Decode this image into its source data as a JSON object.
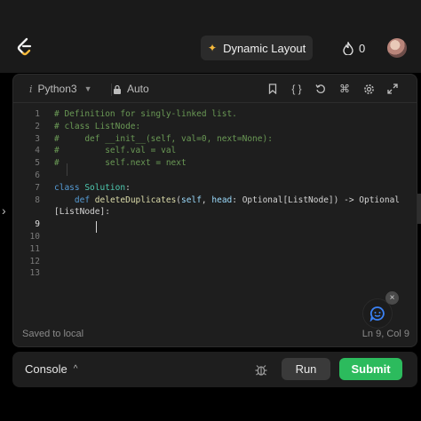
{
  "header": {
    "dynamic_layout_label": "Dynamic Layout",
    "streak_count": "0",
    "logo_icon": "leetcode-logo-icon",
    "spark_icon": "sparkle-icon",
    "streak_icon": "fire-icon"
  },
  "editor": {
    "toolbar": {
      "info_glyph": "i",
      "language": "Python3",
      "mode": "Auto",
      "icons": [
        "bookmark-icon",
        "braces-icon",
        "reset-icon",
        "command-icon",
        "settings-icon",
        "fullscreen-icon"
      ]
    },
    "code_lines": [
      {
        "n": "1",
        "parts": [
          {
            "t": "# Definition for singly-linked list.",
            "c": "cmt"
          }
        ]
      },
      {
        "n": "2",
        "parts": [
          {
            "t": "# class ListNode:",
            "c": "cmt"
          }
        ]
      },
      {
        "n": "3",
        "parts": [
          {
            "t": "#     def __init__(self, val=0, next=None):",
            "c": "cmt"
          }
        ]
      },
      {
        "n": "4",
        "parts": [
          {
            "t": "#         self.val = val",
            "c": "cmt"
          }
        ]
      },
      {
        "n": "5",
        "parts": [
          {
            "t": "#         self.next = next",
            "c": "cmt"
          }
        ]
      },
      {
        "n": "6",
        "parts": []
      },
      {
        "n": "7",
        "parts": [
          {
            "t": "class ",
            "c": "kw"
          },
          {
            "t": "Solution",
            "c": "cls"
          },
          {
            "t": ":",
            "c": ""
          }
        ]
      },
      {
        "n": "8",
        "parts": [
          {
            "t": "    ",
            "c": ""
          },
          {
            "t": "def ",
            "c": "kw"
          },
          {
            "t": "deleteDuplicates",
            "c": "fn"
          },
          {
            "t": "(",
            "c": ""
          },
          {
            "t": "self",
            "c": "param"
          },
          {
            "t": ", ",
            "c": ""
          },
          {
            "t": "head",
            "c": "param"
          },
          {
            "t": ": Optional[ListNode]) -> Optional",
            "c": ""
          }
        ]
      },
      {
        "n": "",
        "parts": [
          {
            "t": "[ListNode]:",
            "c": ""
          }
        ]
      },
      {
        "n": "9",
        "parts": [],
        "active": true
      },
      {
        "n": "10",
        "parts": []
      },
      {
        "n": "11",
        "parts": []
      },
      {
        "n": "12",
        "parts": []
      },
      {
        "n": "13",
        "parts": []
      }
    ],
    "status_left": "Saved to local",
    "status_right": "Ln 9, Col 9"
  },
  "side": {
    "left_arrow_icon": "chevron-right-icon",
    "panel_tab_icon": "document-icon"
  },
  "chat": {
    "fab_icon": "chat-bubble-icon",
    "close_glyph": "×"
  },
  "bottom": {
    "console_label": "Console",
    "console_chevron": "^",
    "run_label": "Run",
    "submit_label": "Submit",
    "debug_icon": "bug-icon"
  },
  "colors": {
    "submit_green": "#2cbb5d",
    "accent_gold": "#f5b93b",
    "comment_green": "#6a9955",
    "keyword_blue": "#569cd6"
  }
}
